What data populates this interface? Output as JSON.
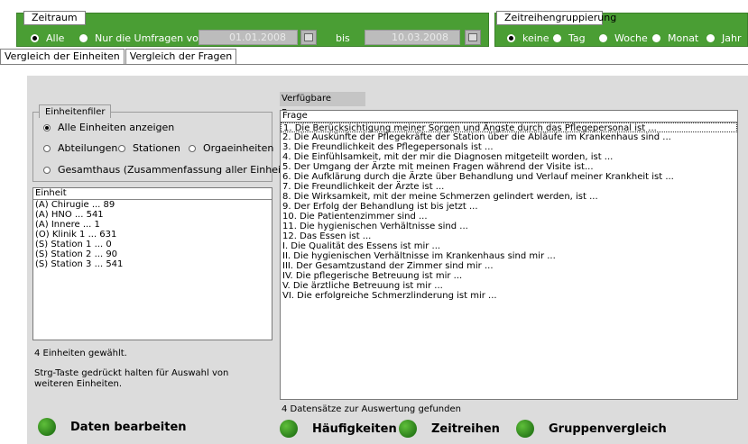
{
  "zeitraum": {
    "legend": "Zeitraum",
    "option_alle": "Alle",
    "option_von": "Nur die Umfragen von",
    "date_from": "01.01.2008",
    "bis": "bis",
    "date_to": "10.03.2008"
  },
  "gruppierung": {
    "legend": "Zeitreihengruppierung",
    "options": [
      "keine",
      "Tag",
      "Woche",
      "Monat",
      "Jahr"
    ],
    "selected": "keine"
  },
  "tabs": [
    {
      "label": "Vergleich der Einheiten",
      "active": true
    },
    {
      "label": "Vergleich der Fragen",
      "active": false
    }
  ],
  "filter": {
    "legend": "Einheitenfiler",
    "alle": "Alle Einheiten anzeigen",
    "abteilungen": "Abteilungen",
    "stationen": "Stationen",
    "orgaeinheiten": "Orgaeinheiten",
    "gesamthaus": "Gesamthaus (Zusammenfassung aller Einheiten)"
  },
  "einheiten": {
    "header": "Einheit",
    "items": [
      "(A) Chirugie ... 89",
      "(A) HNO ... 541",
      "(A) Innere ... 1",
      "(O) Klinik 1 ... 631",
      "(S) Station 1 ... 0",
      "(S) Station 2 ... 90",
      "(S) Station 3 ... 541"
    ],
    "selected_count_text": "4 Einheiten gewählt.",
    "hint": "Strg-Taste gedrückt halten für Auswahl von weiteren Einheiten."
  },
  "fragen": {
    "label": "Verfügbare Fragen:",
    "header": "Frage",
    "items": [
      "1. Die Berücksichtigung meiner Sorgen und Ängste durch das Pflegepersonal ist ...",
      "2. Die Auskünfte der Pflegekräfte der Station über die Abläufe im Krankenhaus sind ...",
      "3. Die Freundlichkeit des Pflegepersonals ist ...",
      "4. Die Einfühlsamkeit, mit der mir die Diagnosen mitgeteilt worden, ist ...",
      "5. Der Umgang der Ärzte mit meinen Fragen während der Visite ist...",
      "6. Die Aufklärung durch die Ärzte über Behandlung und Verlauf meiner Krankheit ist ...",
      "7. Die Freundlichkeit der Ärzte ist ...",
      "8. Die Wirksamkeit, mit der meine Schmerzen gelindert werden, ist ...",
      "9. Der Erfolg der Behandlung ist bis jetzt ...",
      "10. Die Patientenzimmer sind ...",
      "11. Die hygienischen Verhältnisse sind ...",
      "12. Das Essen ist ...",
      "I. Die Qualität des Essens ist mir ...",
      "II. Die hygienischen Verhältnisse im Krankenhaus sind mir ...",
      "III. Der Gesamtzustand der Zimmer sind mir ...",
      "IV. Die pflegerische Betreuung ist mir ...",
      "V. Die ärztliche Betreuung ist mir ...",
      "VI. Die erfolgreiche Schmerzlinderung ist mir ..."
    ],
    "status": "4 Datensätze zur Auswertung gefunden"
  },
  "buttons": {
    "daten_bearbeiten": "Daten bearbeiten",
    "haeufigkeiten": "Häufigkeiten",
    "zeitreihen": "Zeitreihen",
    "gruppenvergleich": "Gruppenvergleich"
  },
  "colors": {
    "accent_green": "#4a9e34",
    "panel_gray": "#dcdcdc"
  }
}
